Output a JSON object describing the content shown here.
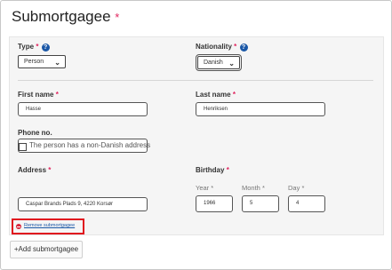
{
  "title": "Submortgagee",
  "required_marker": "*",
  "type": {
    "label": "Type",
    "value": "Person"
  },
  "nationality": {
    "label": "Nationality",
    "value": "Danish"
  },
  "first_name": {
    "label": "First name",
    "value": "Hasse"
  },
  "last_name": {
    "label": "Last name",
    "value": "Henriksen"
  },
  "phone": {
    "label": "Phone no.",
    "value": ""
  },
  "address": {
    "label": "Address",
    "non_danish_label": "The person has a non-Danish address",
    "value": "Caspar Brands Plads 9, 4220 Korsør"
  },
  "birthday": {
    "label": "Birthday",
    "year_label": "Year",
    "month_label": "Month",
    "day_label": "Day",
    "year": "1966",
    "month": "5",
    "day": "4"
  },
  "remove_link": "Remove submortgagee",
  "add_button": "+Add submortgagee",
  "colors": {
    "required": "#e0245e",
    "help_icon": "#1a57a6",
    "highlight_border": "#e0141e"
  }
}
